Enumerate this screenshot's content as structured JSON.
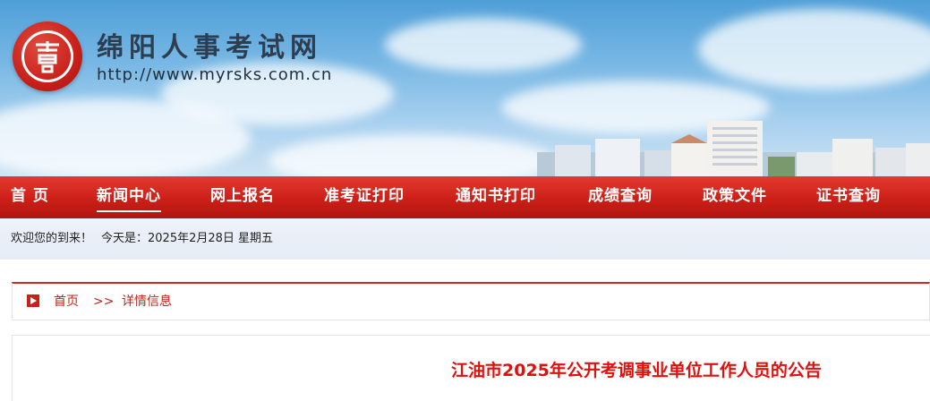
{
  "header": {
    "site_title": "绵阳人事考试网",
    "site_url": "http://www.myrsks.com.cn",
    "logo_icon": "red-seal-logo-icon"
  },
  "nav": {
    "items": [
      {
        "label": "首 页"
      },
      {
        "label": "新闻中心",
        "active": true
      },
      {
        "label": "网上报名"
      },
      {
        "label": "准考证打印"
      },
      {
        "label": "通知书打印"
      },
      {
        "label": "成绩查询"
      },
      {
        "label": "政策文件"
      },
      {
        "label": "证书查询"
      }
    ]
  },
  "welcome": {
    "greeting": "欢迎您的到来！",
    "date_text": "今天是：2025年2月28日 星期五"
  },
  "breadcrumb": {
    "icon": "play-arrow-icon",
    "home": "首页",
    "separator": ">>",
    "current": "详情信息"
  },
  "article": {
    "title": "江油市2025年公开考调事业单位工作人员的公告"
  },
  "colors": {
    "nav_red": "#cc1f18",
    "title_red": "#e0100c",
    "breadcrumb_red": "#c9201a"
  }
}
